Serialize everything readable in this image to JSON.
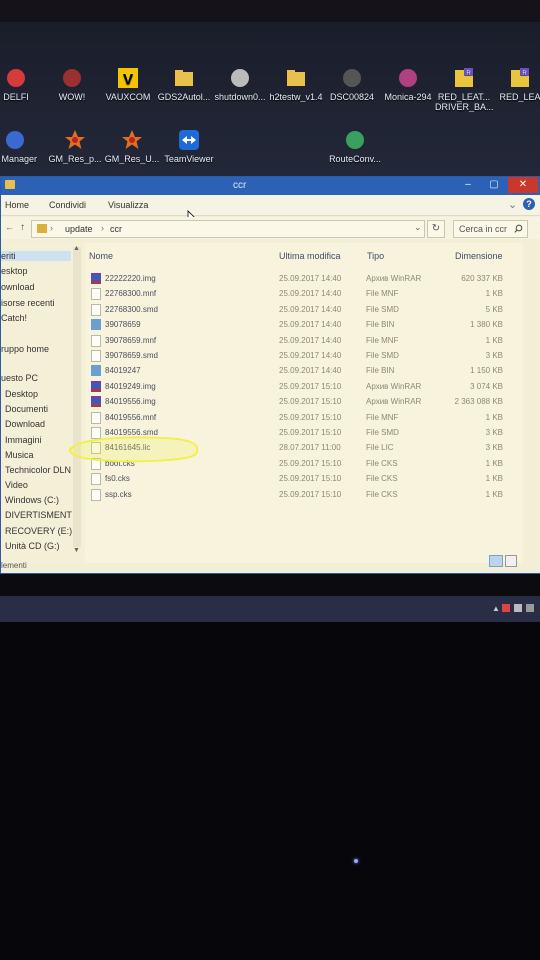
{
  "desktop": {
    "row1": [
      {
        "label": "DELFI",
        "icon": "delfi-app-icon",
        "color": "#d73a3a"
      },
      {
        "label": "WOW!",
        "icon": "wow-app-icon",
        "color": "#9a3030"
      },
      {
        "label": "VAUXCOM",
        "icon": "vauxcom-app-icon",
        "color": "#f2c500"
      },
      {
        "label": "GDS2Autol...",
        "icon": "folder-icon",
        "color": "#e8c04c"
      },
      {
        "label": "shutdown0...",
        "icon": "shortcut-icon",
        "color": "#bbbbbb"
      },
      {
        "label": "h2testw_v1.4",
        "icon": "folder-icon",
        "color": "#e8c04c"
      },
      {
        "label": "DSC00824",
        "icon": "image-file-icon",
        "color": "#555555"
      },
      {
        "label": "Monica-294",
        "icon": "monica-app-icon",
        "color": "#b04080"
      },
      {
        "label": "RED_LEAT...\nDRIVER_BA...",
        "icon": "winrar-icon",
        "color": "#6a4fc0"
      },
      {
        "label": "RED_LEA",
        "icon": "winrar-icon",
        "color": "#6a4fc0"
      }
    ],
    "row2": [
      {
        "label": "X Manager",
        "icon": "xmanager-app-icon",
        "color": "#3a6ad0"
      },
      {
        "label": "GM_Res_p...",
        "icon": "gm-star-icon",
        "color": "#e07020"
      },
      {
        "label": "GM_Res_U...",
        "icon": "gm-star-icon",
        "color": "#e07020"
      },
      {
        "label": "TeamViewer",
        "icon": "teamviewer-icon",
        "color": "#1e6bd8"
      },
      {
        "label": "RouteConv...",
        "icon": "routeconv-icon",
        "color": "#3aa060"
      }
    ]
  },
  "window": {
    "title": "ccr",
    "buttons": {
      "minimize": "–",
      "maximize": "▢",
      "close": "✕"
    },
    "ribbon_tabs": [
      "Home",
      "Condividi",
      "Visualizza"
    ],
    "ribbon_help": "?",
    "ribbon_expand": "⌄",
    "nav": {
      "back": "←",
      "up": "↑"
    },
    "address": {
      "segments": [
        "update",
        "ccr"
      ],
      "separator": "›",
      "dropdown": "⌄",
      "refresh": "↻"
    },
    "search_placeholder": "Cerca in ccr",
    "columns": [
      "Nome",
      "Ultima modifica",
      "Tipo",
      "Dimensione"
    ],
    "sidebar": [
      "eriti",
      "esktop",
      "ownload",
      "isorse recenti",
      "Catch!",
      "ruppo home",
      "uesto PC",
      "Desktop",
      "Documenti",
      "Download",
      "Immagini",
      "Musica",
      "Technicolor DLN",
      "Video",
      "Windows (C:)",
      "DIVERTISMENT (I",
      "RECOVERY (E:)",
      "Unità CD (G:)"
    ],
    "files": [
      {
        "name": "22222220.img",
        "date": "25.09.2017 14:40",
        "type": "Архив WinRAR",
        "size": "620 337 KB",
        "icon": "winrar-file-icon"
      },
      {
        "name": "22768300.mnf",
        "date": "25.09.2017 14:40",
        "type": "File MNF",
        "size": "1 KB",
        "icon": "file-icon"
      },
      {
        "name": "22768300.smd",
        "date": "25.09.2017 14:40",
        "type": "File SMD",
        "size": "5 KB",
        "icon": "file-icon"
      },
      {
        "name": "39078659",
        "date": "25.09.2017 14:40",
        "type": "File BIN",
        "size": "1 380 KB",
        "icon": "bin-file-icon"
      },
      {
        "name": "39078659.mnf",
        "date": "25.09.2017 14:40",
        "type": "File MNF",
        "size": "1 KB",
        "icon": "file-icon"
      },
      {
        "name": "39078659.smd",
        "date": "25.09.2017 14:40",
        "type": "File SMD",
        "size": "3 KB",
        "icon": "file-icon"
      },
      {
        "name": "84019247",
        "date": "25.09.2017 14:40",
        "type": "File BIN",
        "size": "1 150 KB",
        "icon": "bin-file-icon"
      },
      {
        "name": "84019249.img",
        "date": "25.09.2017 15:10",
        "type": "Архив WinRAR",
        "size": "3 074 KB",
        "icon": "winrar-file-icon"
      },
      {
        "name": "84019556.img",
        "date": "25.09.2017 15:10",
        "type": "Архив WinRAR",
        "size": "2 363 088 KB",
        "icon": "winrar-file-icon"
      },
      {
        "name": "84019556.mnf",
        "date": "25.09.2017 15:10",
        "type": "File MNF",
        "size": "1 KB",
        "icon": "file-icon"
      },
      {
        "name": "84019556.smd",
        "date": "25.09.2017 15:10",
        "type": "File SMD",
        "size": "3 KB",
        "icon": "file-icon"
      },
      {
        "name": "84161645.lic",
        "date": "28.07.2017 11:00",
        "type": "File LIC",
        "size": "3 KB",
        "icon": "file-icon"
      },
      {
        "name": "boot.cks",
        "date": "25.09.2017 15:10",
        "type": "File CKS",
        "size": "1 KB",
        "icon": "file-icon"
      },
      {
        "name": "fs0.cks",
        "date": "25.09.2017 15:10",
        "type": "File CKS",
        "size": "1 KB",
        "icon": "file-icon"
      },
      {
        "name": "ssp.cks",
        "date": "25.09.2017 15:10",
        "type": "File CKS",
        "size": "1 KB",
        "icon": "file-icon"
      }
    ],
    "status": "lementi",
    "highlight_color": "#f2f040"
  }
}
